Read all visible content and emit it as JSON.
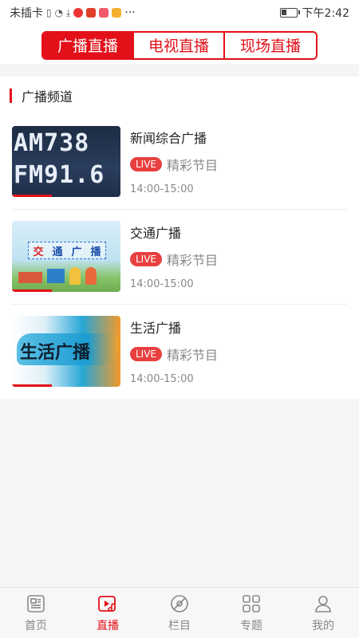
{
  "status_bar": {
    "carrier": "未插卡",
    "more": "···",
    "time": "下午2:42"
  },
  "tabs": [
    {
      "label": "广播直播",
      "active": true
    },
    {
      "label": "电视直播",
      "active": false
    },
    {
      "label": "现场直播",
      "active": false
    }
  ],
  "section": {
    "title": "广播频道"
  },
  "channels": [
    {
      "name": "新闻综合广播",
      "live": "LIVE",
      "program": "精彩节目",
      "time": "14:00-15:00",
      "thumb_line1": "AM738",
      "thumb_line2": "FM91.6"
    },
    {
      "name": "交通广播",
      "live": "LIVE",
      "program": "精彩节目",
      "time": "14:00-15:00",
      "thumb_chars": [
        "交",
        "通",
        "广",
        "播"
      ]
    },
    {
      "name": "生活广播",
      "live": "LIVE",
      "program": "精彩节目",
      "time": "14:00-15:00",
      "thumb_text": "生活广播"
    }
  ],
  "nav": [
    {
      "label": "首页",
      "icon": "news-icon",
      "active": false
    },
    {
      "label": "直播",
      "icon": "live-play-icon",
      "active": true
    },
    {
      "label": "栏目",
      "icon": "disc-icon",
      "active": false
    },
    {
      "label": "专题",
      "icon": "grid-icon",
      "active": false
    },
    {
      "label": "我的",
      "icon": "user-icon",
      "active": false
    }
  ],
  "colors": {
    "accent": "#e3101a",
    "live_badge": "#e84040"
  }
}
